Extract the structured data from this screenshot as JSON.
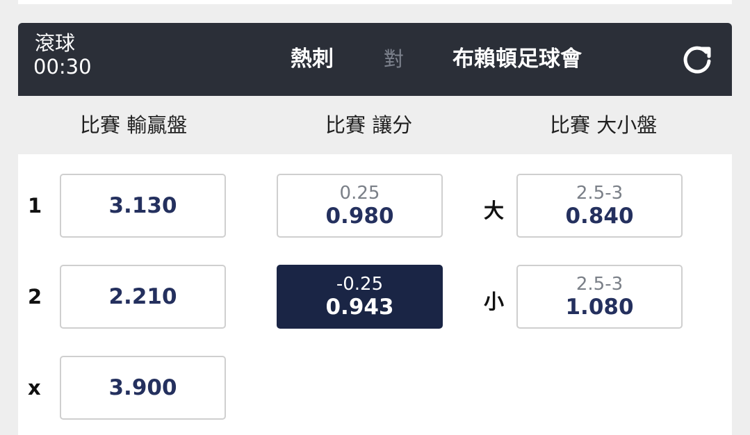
{
  "match": {
    "status_label": "滾球",
    "clock": "00:30",
    "home_team": "熱刺",
    "vs_label": "對",
    "away_team": "布賴頓足球會",
    "refresh_icon": "refresh-icon"
  },
  "markets": {
    "moneyline": {
      "title": "比賽 輸贏盤",
      "rows": [
        {
          "label": "1",
          "price": "3.130"
        },
        {
          "label": "2",
          "price": "2.210"
        },
        {
          "label": "x",
          "price": "3.900"
        }
      ]
    },
    "handicap": {
      "title": "比賽 讓分",
      "rows": [
        {
          "line": "0.25",
          "price": "0.980",
          "selected": false
        },
        {
          "line": "-0.25",
          "price": "0.943",
          "selected": true
        }
      ]
    },
    "total": {
      "title": "比賽 大小盤",
      "rows": [
        {
          "label": "大",
          "line": "2.5-3",
          "price": "0.840"
        },
        {
          "label": "小",
          "line": "2.5-3",
          "price": "1.080"
        }
      ]
    }
  },
  "colors": {
    "header_bg": "#2b2f38",
    "selected_bg": "#1a2545",
    "price_text": "#24305e"
  }
}
